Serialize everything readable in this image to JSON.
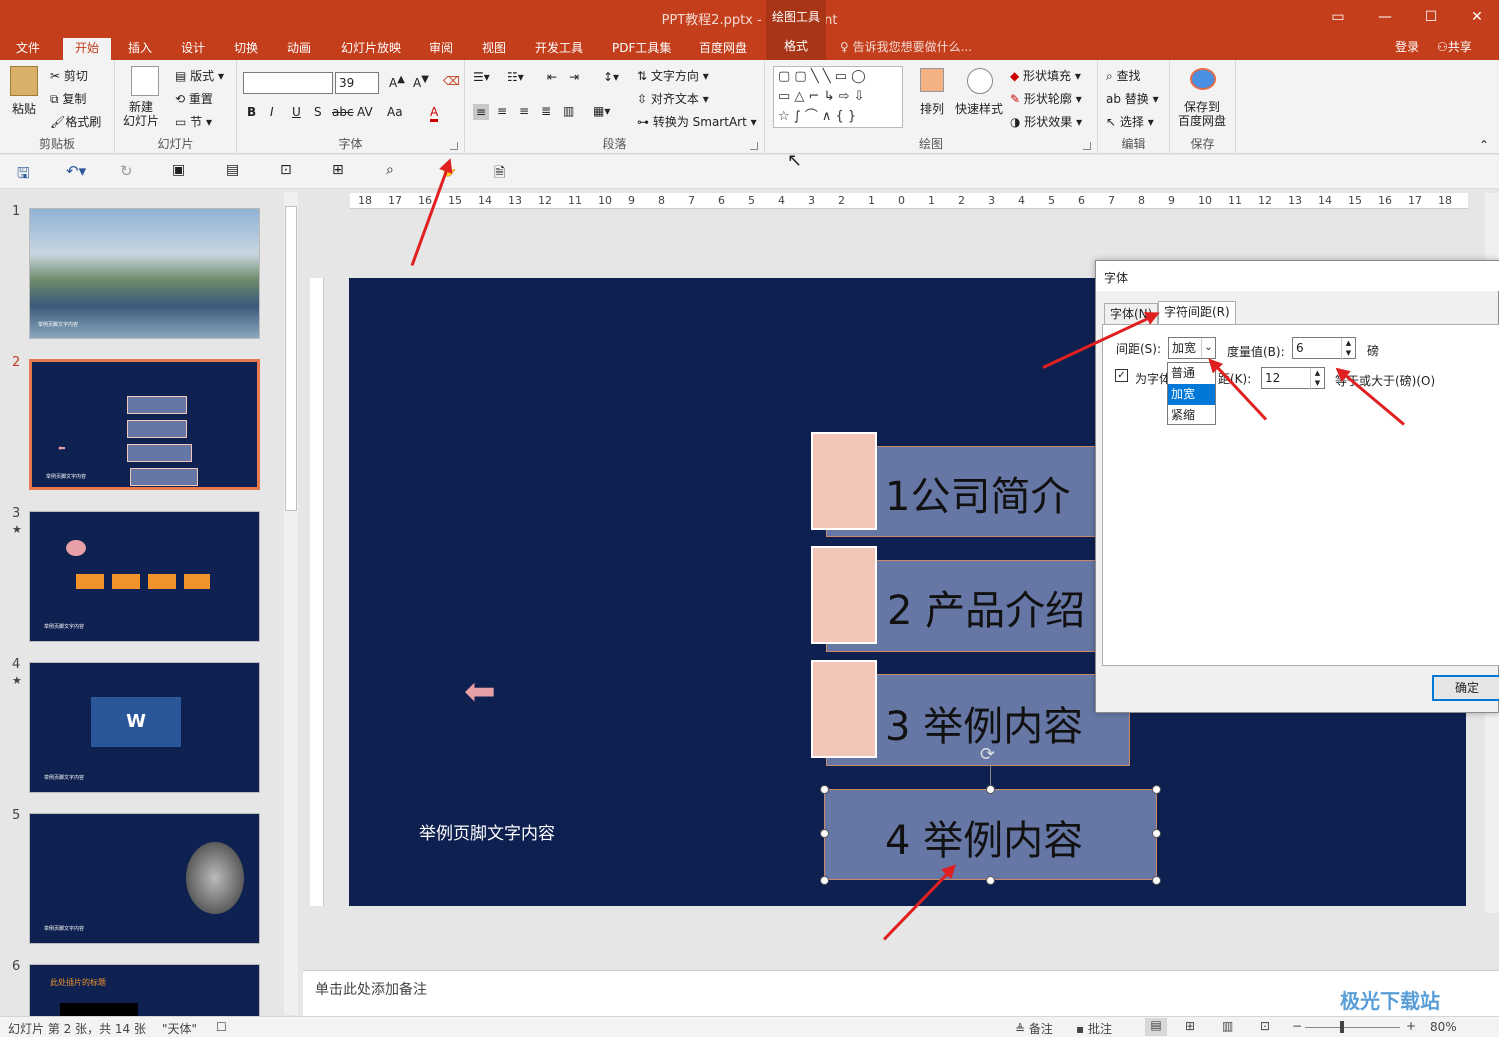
{
  "titlebar": {
    "title": "PPT教程2.pptx - PowerPoint",
    "context_tab": "绘图工具"
  },
  "tabs": [
    "文件",
    "开始",
    "插入",
    "设计",
    "切换",
    "动画",
    "幻灯片放映",
    "审阅",
    "视图",
    "开发工具",
    "PDF工具集",
    "百度网盘",
    "格式"
  ],
  "tell_me": "告诉我您想要做什么...",
  "login": "登录",
  "share": "共享",
  "ribbon": {
    "clipboard": {
      "paste": "粘贴",
      "cut": "剪切",
      "copy": "复制",
      "format_painter": "格式刷",
      "label": "剪贴板"
    },
    "slides": {
      "new_slide": "新建\n幻灯片",
      "layout": "版式",
      "reset": "重置",
      "section": "节",
      "label": "幻灯片"
    },
    "font": {
      "font_name": "",
      "font_size": "39",
      "bold": "B",
      "italic": "I",
      "underline": "U",
      "shadow": "S",
      "strike": "abc",
      "spacing": "AV",
      "case": "Aa",
      "color": "A",
      "label": "字体"
    },
    "paragraph": {
      "text_direction": "文字方向",
      "align_text": "对齐文本",
      "smartart": "转换为 SmartArt",
      "label": "段落"
    },
    "drawing": {
      "arrange": "排列",
      "quick_styles": "快速样式",
      "shape_fill": "形状填充",
      "shape_outline": "形状轮廓",
      "shape_effects": "形状效果",
      "label": "绘图"
    },
    "editing": {
      "find": "查找",
      "replace": "替换",
      "select": "选择",
      "label": "编辑"
    },
    "save": {
      "save_to_baidu": "保存到\n百度网盘",
      "label": "保存"
    }
  },
  "thumbnails": {
    "numbers": [
      "1",
      "2",
      "3",
      "4",
      "5",
      "6"
    ],
    "slide6_title": "此处插片的标题",
    "footer": "举例页脚文字内容"
  },
  "slide": {
    "items": [
      "1公司简介",
      "2 产品介绍",
      "3  举例内容",
      "4  举例内容"
    ],
    "footer": "举例页脚文字内容"
  },
  "ruler": {
    "h_ticks": [
      "18",
      "17",
      "16",
      "15",
      "14",
      "13",
      "12",
      "11",
      "10",
      "9",
      "8",
      "7",
      "6",
      "5",
      "4",
      "3",
      "2",
      "1",
      "0",
      "1",
      "2",
      "3",
      "4",
      "5",
      "6",
      "7",
      "8",
      "9",
      "10",
      "11",
      "12",
      "13",
      "14",
      "15",
      "16",
      "17",
      "18"
    ]
  },
  "notes_placeholder": "单击此处添加备注",
  "status": {
    "slide_info": "幻灯片 第 2 张，共 14 张",
    "theme": "\"天体\"",
    "notes": "备注",
    "comments": "批注",
    "zoom": "80%"
  },
  "dialog": {
    "title": "字体",
    "tabs": [
      "字体(N)",
      "字符间距(R)"
    ],
    "spacing_label": "间距(S):",
    "spacing_value": "加宽",
    "by_label": "度量值(B):",
    "by_value": "6",
    "unit": "磅",
    "kerning_label": "为字体",
    "kerning_label2": "距(K):",
    "kerning_value": "12",
    "kerning_suffix": "等于或大于(磅)(O)",
    "options": [
      "普通",
      "加宽",
      "紧缩"
    ],
    "ok": "确定"
  },
  "watermark": "极光下载站"
}
